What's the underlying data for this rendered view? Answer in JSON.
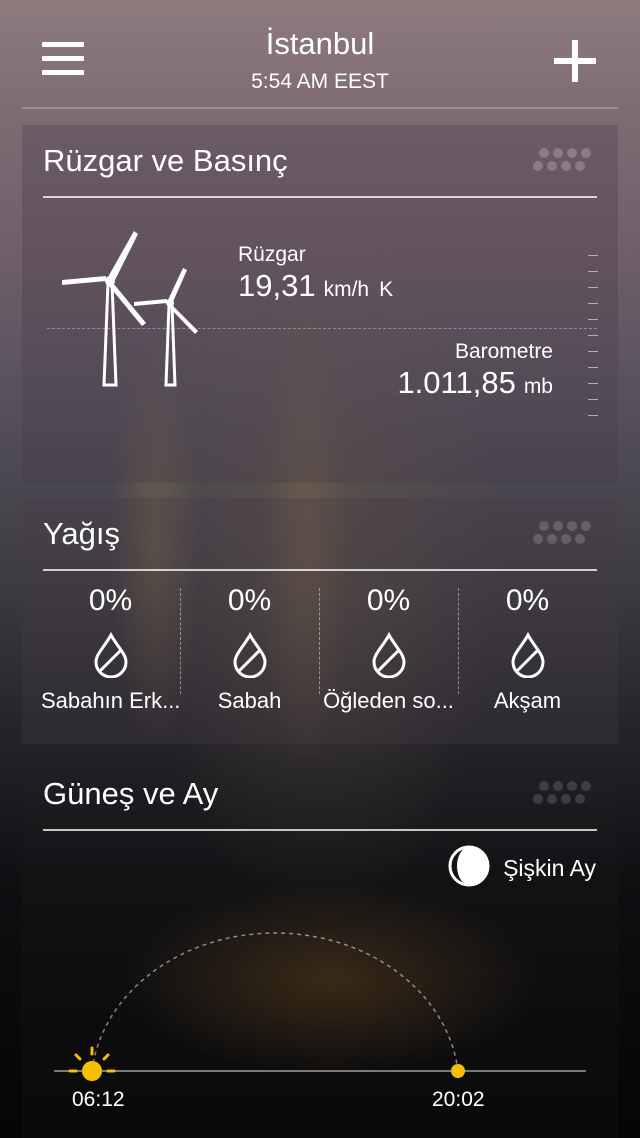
{
  "header": {
    "city": "İstanbul",
    "time": "5:54 AM EEST"
  },
  "wind_card": {
    "title": "Rüzgar ve Basınç",
    "wind_label": "Rüzgar",
    "wind_value": "19,31",
    "wind_unit": "km/h",
    "wind_direction": "K",
    "barometer_label": "Barometre",
    "barometer_value": "1.011,85",
    "barometer_unit": "mb"
  },
  "rain_card": {
    "title": "Yağış",
    "periods": [
      {
        "percent": "0%",
        "name": "Sabahın Erk..."
      },
      {
        "percent": "0%",
        "name": "Sabah"
      },
      {
        "percent": "0%",
        "name": "Öğleden so..."
      },
      {
        "percent": "0%",
        "name": "Akşam"
      }
    ]
  },
  "sun_card": {
    "title": "Güneş ve Ay",
    "moon_phase": "Şişkin Ay",
    "sunrise": "06:12",
    "sunset": "20:02"
  },
  "colors": {
    "sun": "#f5c000",
    "text": "#ffffff"
  }
}
